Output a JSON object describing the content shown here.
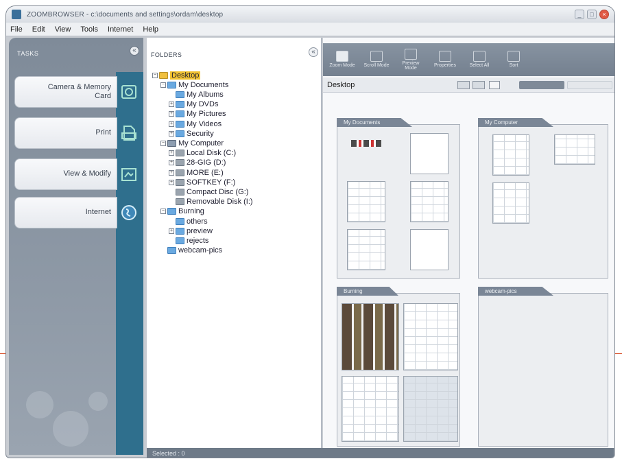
{
  "window": {
    "title": "ZOOMBROWSER - c:\\documents and settings\\ordam\\desktop"
  },
  "controls": {
    "minimize": "_",
    "maximize": "□",
    "close": "×",
    "collapse": "«"
  },
  "menu": [
    "File",
    "Edit",
    "View",
    "Tools",
    "Internet",
    "Help"
  ],
  "tasks": {
    "header": "TASKS",
    "items": [
      {
        "label": "Camera & Memory Card",
        "icon": "camera-icon"
      },
      {
        "label": "Print",
        "icon": "print-icon"
      },
      {
        "label": "View & Modify",
        "icon": "view-modify-icon"
      },
      {
        "label": "Internet",
        "icon": "internet-icon"
      }
    ]
  },
  "folders": {
    "header": "FOLDERS",
    "tree": [
      {
        "label": "Desktop",
        "depth": 0,
        "expander": "−",
        "type": "yellow",
        "selected": true
      },
      {
        "label": "My Documents",
        "depth": 1,
        "expander": "−",
        "type": "folder"
      },
      {
        "label": "My Albums",
        "depth": 2,
        "expander": "",
        "type": "folder"
      },
      {
        "label": "My DVDs",
        "depth": 2,
        "expander": "+",
        "type": "folder"
      },
      {
        "label": "My Pictures",
        "depth": 2,
        "expander": "+",
        "type": "folder"
      },
      {
        "label": "My Videos",
        "depth": 2,
        "expander": "+",
        "type": "folder"
      },
      {
        "label": "Security",
        "depth": 2,
        "expander": "+",
        "type": "folder"
      },
      {
        "label": "My Computer",
        "depth": 1,
        "expander": "−",
        "type": "pc"
      },
      {
        "label": "Local Disk (C:)",
        "depth": 2,
        "expander": "+",
        "type": "drive"
      },
      {
        "label": "28-GIG (D:)",
        "depth": 2,
        "expander": "+",
        "type": "drive"
      },
      {
        "label": "MORE (E:)",
        "depth": 2,
        "expander": "+",
        "type": "drive"
      },
      {
        "label": "SOFTKEY (F:)",
        "depth": 2,
        "expander": "+",
        "type": "drive"
      },
      {
        "label": "Compact Disc (G:)",
        "depth": 2,
        "expander": "",
        "type": "drive"
      },
      {
        "label": "Removable Disk (I:)",
        "depth": 2,
        "expander": "",
        "type": "drive"
      },
      {
        "label": "Burning",
        "depth": 1,
        "expander": "−",
        "type": "folder"
      },
      {
        "label": "others",
        "depth": 2,
        "expander": "",
        "type": "folder"
      },
      {
        "label": "preview",
        "depth": 2,
        "expander": "+",
        "type": "folder"
      },
      {
        "label": "rejects",
        "depth": 2,
        "expander": "",
        "type": "folder"
      },
      {
        "label": "webcam-pics",
        "depth": 1,
        "expander": "",
        "type": "folder"
      }
    ]
  },
  "toolbar": [
    {
      "label": "Zoom Mode",
      "active": true
    },
    {
      "label": "Scroll Mode",
      "active": false
    },
    {
      "label": "Preview Mode",
      "active": false
    },
    {
      "label": "Properties",
      "active": false
    },
    {
      "label": "Select All",
      "active": false
    },
    {
      "label": "Sort",
      "active": false
    }
  ],
  "pathbar": {
    "location": "Desktop"
  },
  "cards": [
    {
      "title": "My Documents"
    },
    {
      "title": "My Computer"
    },
    {
      "title": "Burning"
    },
    {
      "title": "webcam-pics"
    }
  ],
  "status": {
    "text": "Selected : 0"
  }
}
